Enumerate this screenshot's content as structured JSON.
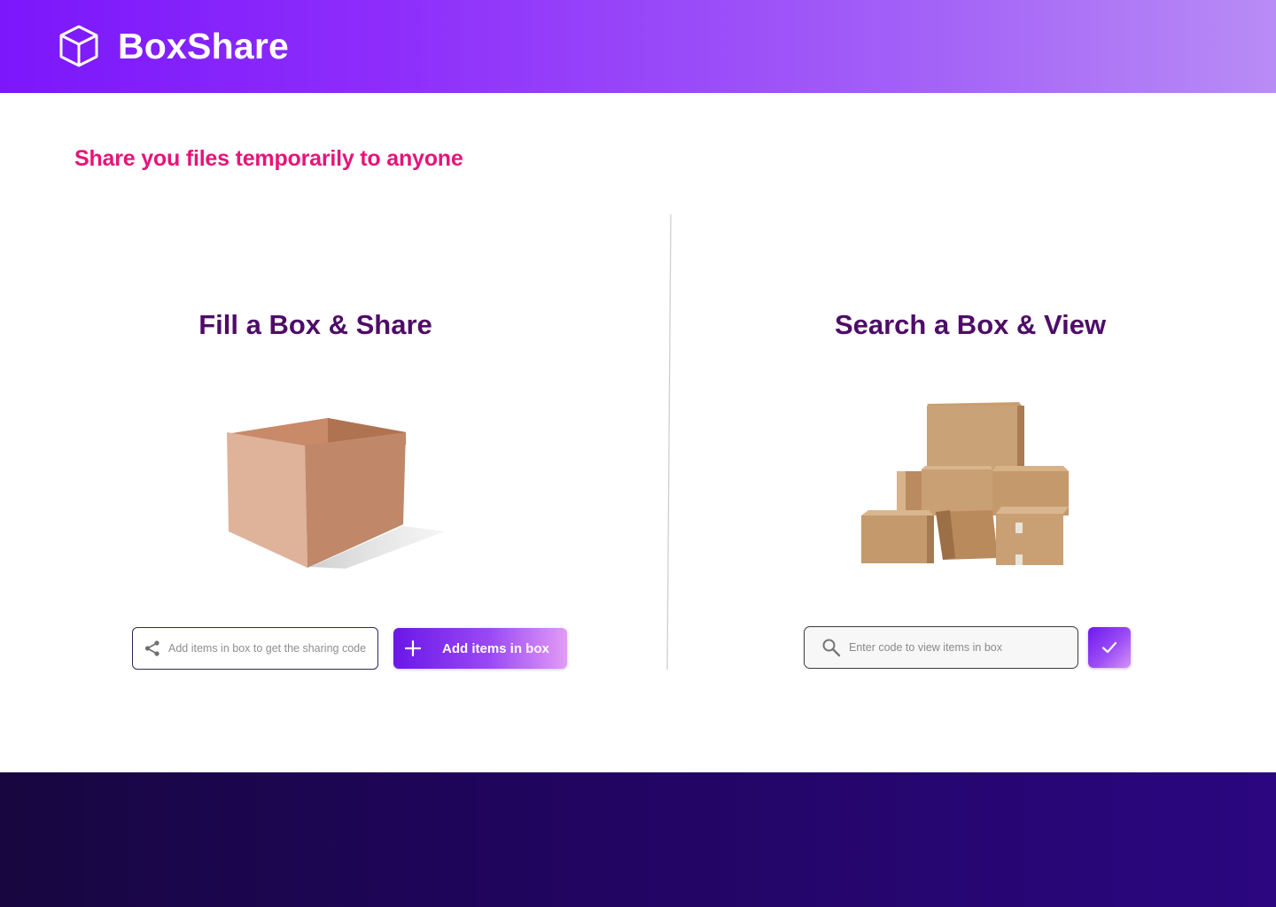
{
  "app": {
    "brand_name": "BoxShare",
    "logo_icon": "cube-outline-icon",
    "header_gradient": [
      "#7b17fb",
      "#b88cf5"
    ],
    "footer_gradient": [
      "#170640",
      "#2b0680"
    ]
  },
  "hero": {
    "tagline": "Share you files temporarily to anyone",
    "tagline_color": "#e6147a"
  },
  "share_section": {
    "title": "Fill a Box & Share",
    "illustration": "open-cardboard-box",
    "code_field": {
      "icon": "share-icon",
      "value": "",
      "placeholder": "Add items in box to get the sharing code"
    },
    "add_button": {
      "icon": "plus-icon",
      "label": "Add items in box"
    }
  },
  "view_section": {
    "title": "Search a Box & View",
    "illustration": "stacked-cardboard-boxes",
    "search_field": {
      "icon": "search-icon",
      "value": "",
      "placeholder": "Enter code to view items in box"
    },
    "submit_button": {
      "icon": "check-icon"
    }
  },
  "colors": {
    "section_title": "#4e0c68",
    "accent_purple": "#7b17fb"
  }
}
